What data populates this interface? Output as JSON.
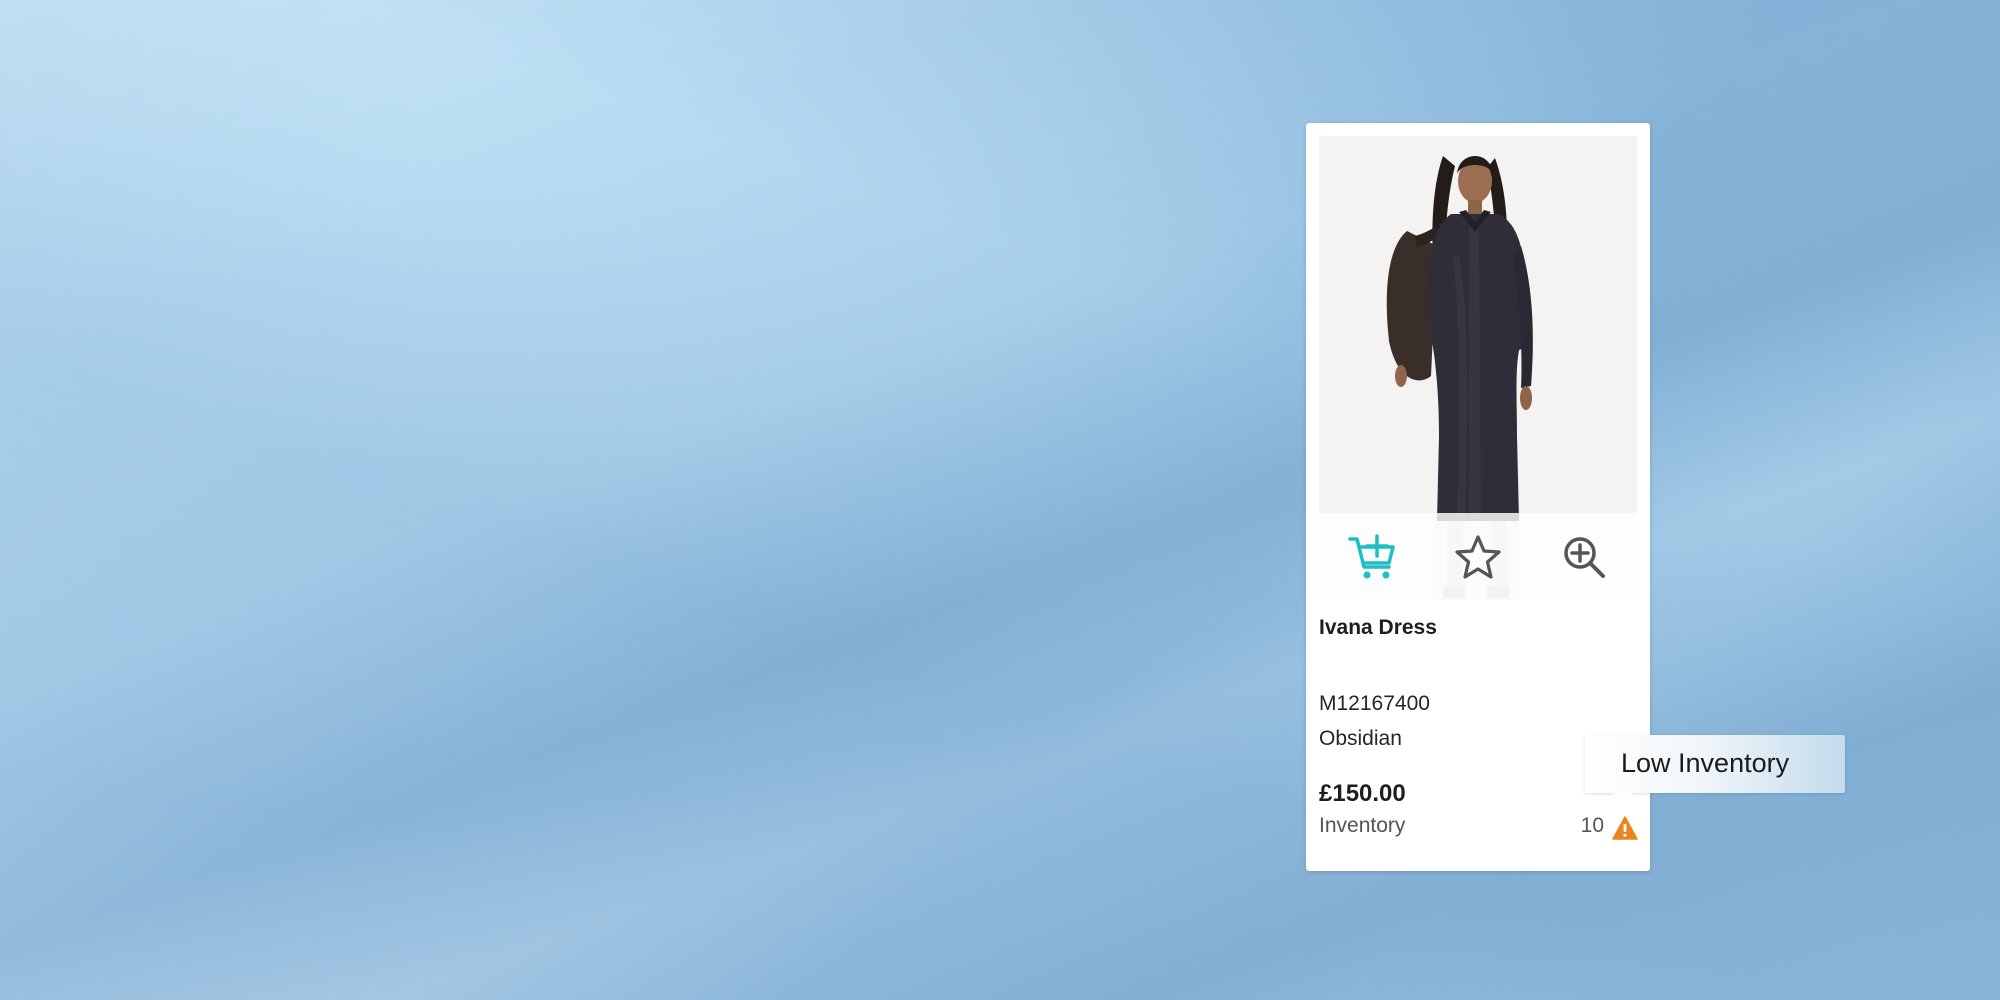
{
  "product": {
    "name": "Ivana Dress",
    "sku": "M12167400",
    "color": "Obsidian",
    "price": "£150.00",
    "inventory_label": "Inventory",
    "inventory_count": "10"
  },
  "actions": {
    "add_to_cart_icon": "cart-plus-icon",
    "favorite_icon": "star-icon",
    "zoom_icon": "zoom-in-icon"
  },
  "tooltip": {
    "text": "Low Inventory"
  },
  "colors": {
    "accent": "#1bbfc4",
    "warning": "#e8851e",
    "icon_gray": "#555555"
  }
}
